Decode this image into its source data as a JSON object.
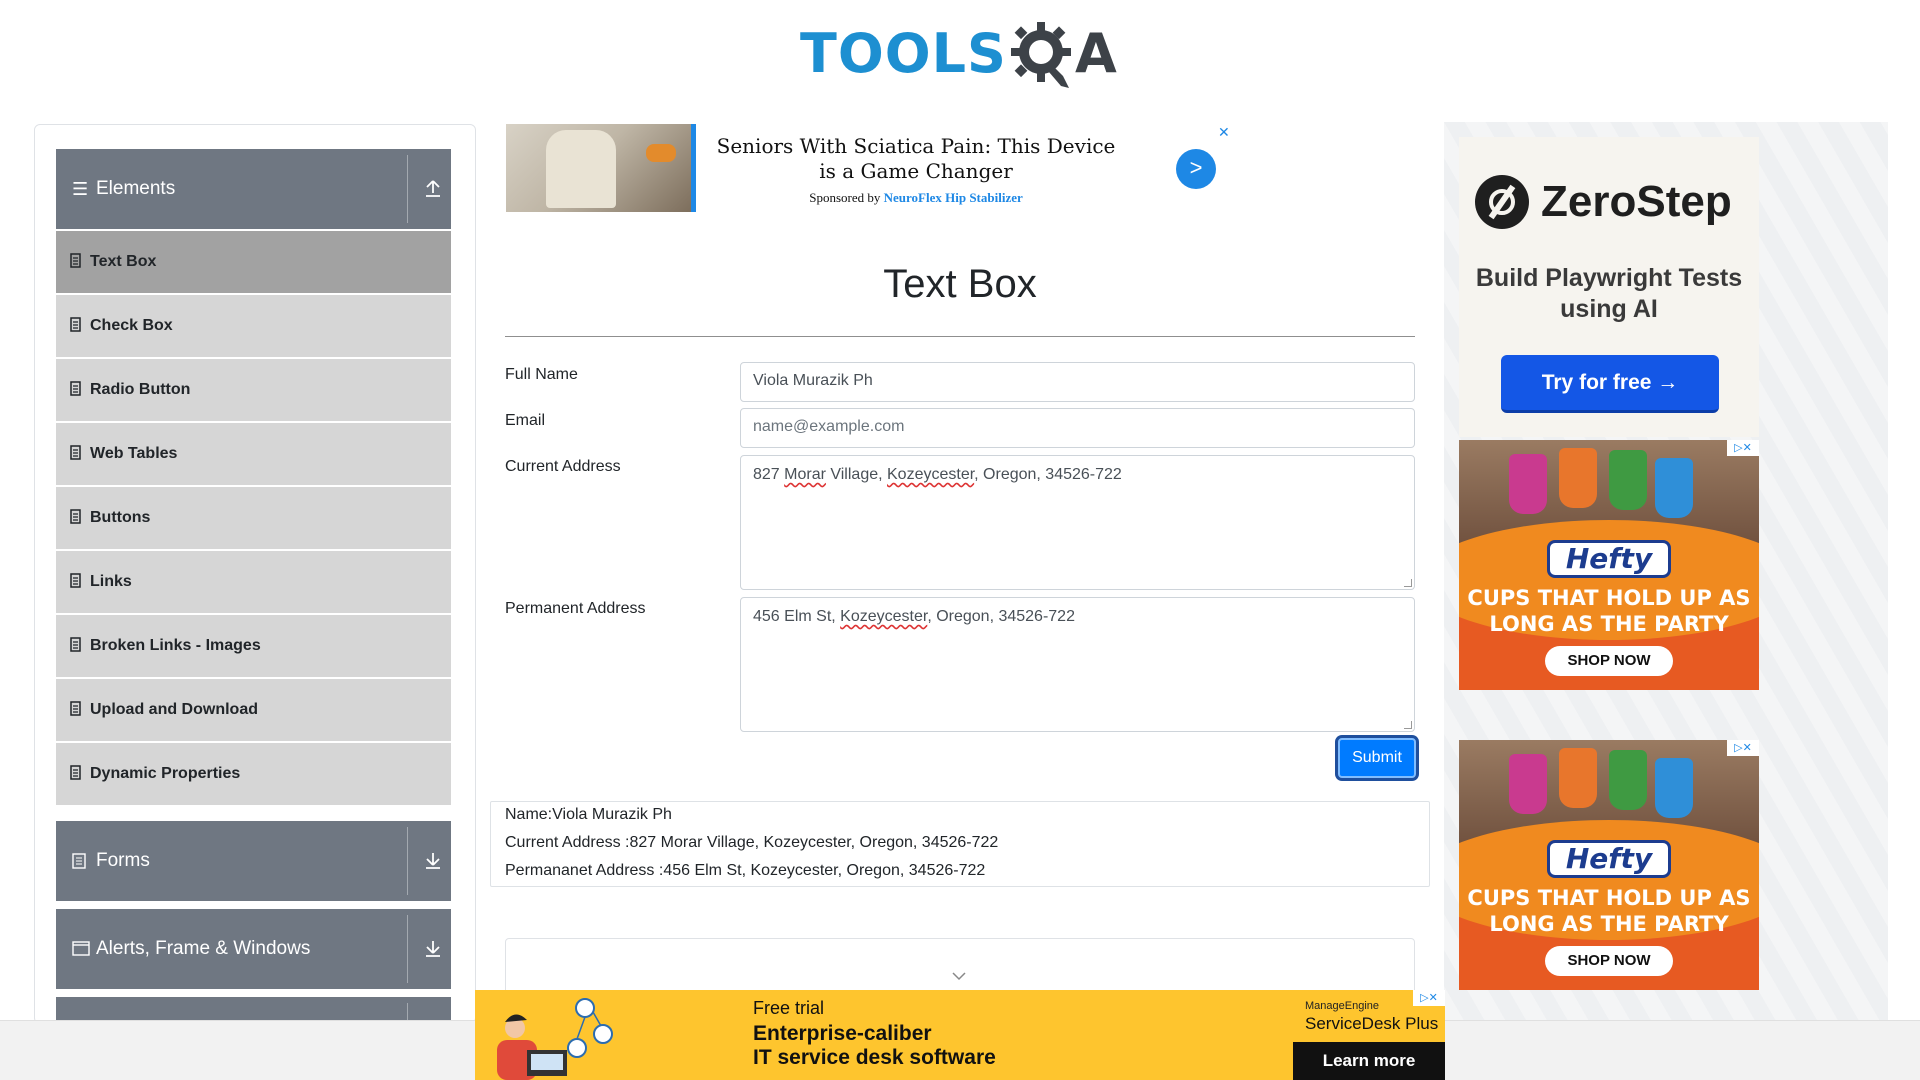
{
  "header": {
    "logo_tools": "TOOLS",
    "logo_qa": "A"
  },
  "sidebar": {
    "groups": [
      {
        "label": "Elements",
        "icon": "hamburger-icon",
        "state": "expanded"
      },
      {
        "label": "Forms",
        "icon": "form-icon",
        "state": "collapsed"
      },
      {
        "label": "Alerts, Frame & Windows",
        "icon": "window-icon",
        "state": "collapsed"
      }
    ],
    "items": [
      {
        "label": "Text Box",
        "active": true
      },
      {
        "label": "Check Box",
        "active": false
      },
      {
        "label": "Radio Button",
        "active": false
      },
      {
        "label": "Web Tables",
        "active": false
      },
      {
        "label": "Buttons",
        "active": false
      },
      {
        "label": "Links",
        "active": false
      },
      {
        "label": "Broken Links - Images",
        "active": false
      },
      {
        "label": "Upload and Download",
        "active": false
      },
      {
        "label": "Dynamic Properties",
        "active": false
      }
    ]
  },
  "top_ad": {
    "headline": "Seniors With Sciatica Pain: This Device is a Game Changer",
    "sponsored_prefix": "Sponsored by",
    "sponsor": "NeuroFlex Hip Stabilizer",
    "go_label": ">",
    "close_label": "✕"
  },
  "main": {
    "title": "Text Box",
    "form": {
      "full_name": {
        "label": "Full Name",
        "value": "Viola Murazik Ph"
      },
      "email": {
        "label": "Email",
        "value": "",
        "placeholder": "name@example.com"
      },
      "current_address": {
        "label": "Current Address",
        "value_parts": [
          "827 ",
          "Morar",
          " Village, ",
          "Kozeycester",
          ", Oregon, 34526-722"
        ]
      },
      "permanent_address": {
        "label": "Permanent Address",
        "value_parts": [
          "456 Elm St, ",
          "Kozeycester",
          ", Oregon, 34526-722"
        ]
      },
      "submit_label": "Submit"
    },
    "output": {
      "name": "Name:Viola Murazik Ph",
      "current_address": "Current Address :827 Morar Village, Kozeycester, Oregon, 34526-722",
      "permanent_address": "Permananet Address :456 Elm St, Kozeycester, Oregon, 34526-722"
    }
  },
  "right_ads": {
    "zerostep": {
      "brand": "ZeroStep",
      "tagline": "Build Playwright Tests using AI",
      "button": "Try for free →"
    },
    "hefty": {
      "brand": "Hefty",
      "line1": "CUPS THAT HOLD UP AS",
      "line2": "LONG AS THE PARTY",
      "cta": "SHOP NOW",
      "adchoice": "▷✕"
    }
  },
  "bottom_ad": {
    "free_trial": "Free trial",
    "line1": "Enterprise-caliber",
    "line2": "IT service desk software",
    "brand_small": "ManageEngine",
    "brand": "ServiceDesk Plus",
    "cta": "Learn more",
    "adchoice": "▷✕"
  },
  "colors": {
    "brand_blue": "#1d8fd1",
    "sidebar_header": "#6f7782",
    "menu_item": "#d6d6d6",
    "menu_active": "#a2a2a2",
    "submit": "#007bff"
  }
}
